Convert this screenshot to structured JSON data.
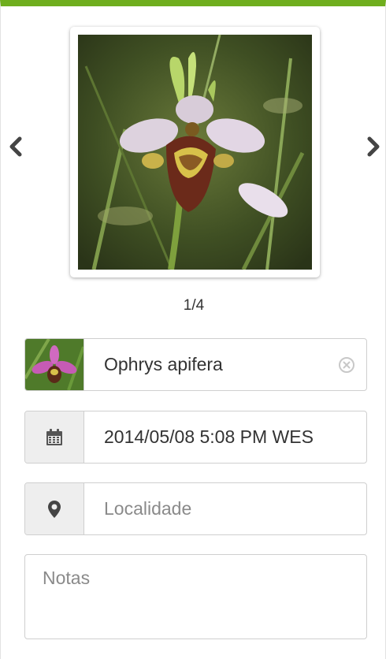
{
  "gallery": {
    "counter": "1/4",
    "prev_icon": "chevron-left-icon",
    "next_icon": "chevron-right-icon"
  },
  "species": {
    "value": "Ophrys apifera",
    "clear_icon": "clear-circle-icon"
  },
  "date": {
    "value": "2014/05/08 5:08 PM WES",
    "icon": "calendar-icon"
  },
  "location": {
    "placeholder": "Localidade",
    "icon": "map-marker-icon"
  },
  "notes": {
    "placeholder": "Notas"
  },
  "colors": {
    "accent": "#6fae1e"
  }
}
